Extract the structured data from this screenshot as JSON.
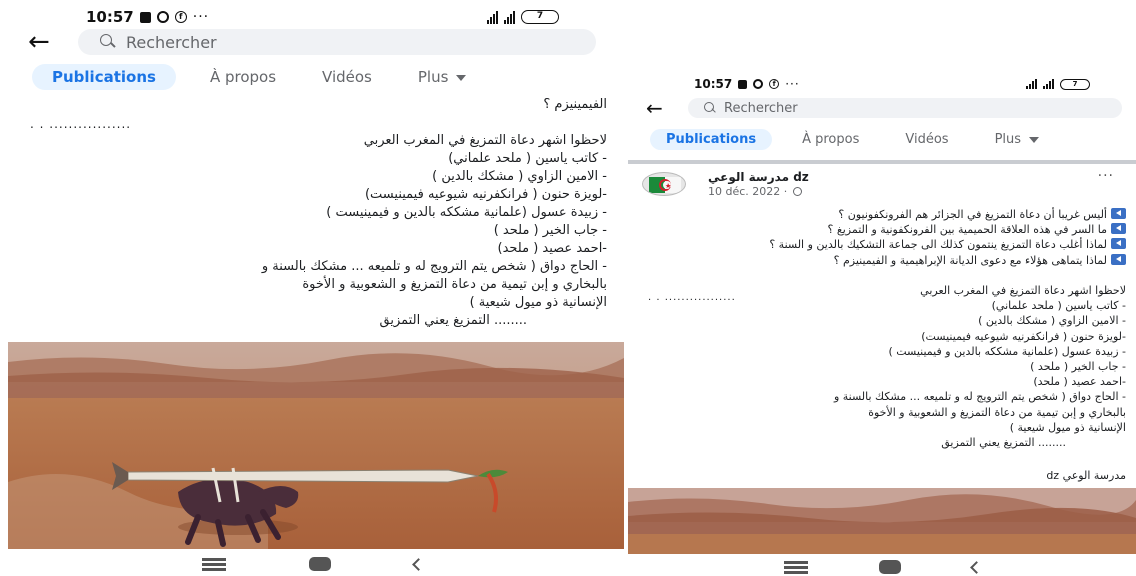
{
  "status": {
    "time": "10:57",
    "fb_letter": "f",
    "dots": "···",
    "battery": "7"
  },
  "search": {
    "placeholder": "Rechercher"
  },
  "tabs": [
    {
      "label": "Publications",
      "active": true
    },
    {
      "label": "À propos",
      "active": false
    },
    {
      "label": "Vidéos",
      "active": false
    },
    {
      "label": "Plus",
      "active": false
    }
  ],
  "post": {
    "author": "مدرسة الوعي dz",
    "date": "10 déc. 2022 · ",
    "more": "···",
    "questions": [
      "أليس غريبا أن دعاة التمزيغ في الجزائر هم الفرونكفونيون ؟",
      "ما السر في هذه العلاقة الحميمية بين الفرونكفونية و التمزيغ ؟",
      "لماذا أغلب دعاة التمزيغ ينتمون كذلك الى جماعة التشكيك بالدين و السنة ؟",
      "لماذا يتماهى هؤلاء مع دعوى الديانة الإبراهيمية و الفيمينيزم ؟"
    ],
    "trailing_fragment": "الفيمينيزم ؟",
    "dots_line": ". .        .................",
    "lines": [
      "لاحظوا اشهر دعاة التمزيغ في المغرب العربي",
      "- كاتب ياسين ( ملحد علماني)",
      "- الامين الزاوي ( مشكك بالدين )",
      "-لويزة حنون ( فرانكفرنيه شيوعيه فيمينيست)",
      "- زبيدة عسول (علمانية مشككه بالدين و فيمينيست )",
      "- جاب الخير ( ملحد )",
      "-احمد عصيد ( ملحد)",
      "- الحاج دواق ( شخص يتم الترويج له و تلميعه ... مشكك بالسنة و",
      "بالبخاري و إبن تيمية من دعاة التمزيغ و الشعوبية و الأخوة",
      "الإنسانية ذو ميول شيعية )",
      "........ التمزيغ يعني التمزيق"
    ],
    "signature": "مدرسة الوعي dz"
  },
  "colors": {
    "accent": "#1b74e4",
    "active_tab_bg": "#e7f3ff",
    "search_bg": "#f0f2f5",
    "muted": "#65676b"
  },
  "icons": [
    "back-arrow-icon",
    "search-icon",
    "caret-down-icon",
    "more-icon",
    "globe-icon",
    "menu-icon",
    "home-icon",
    "back-icon"
  ]
}
